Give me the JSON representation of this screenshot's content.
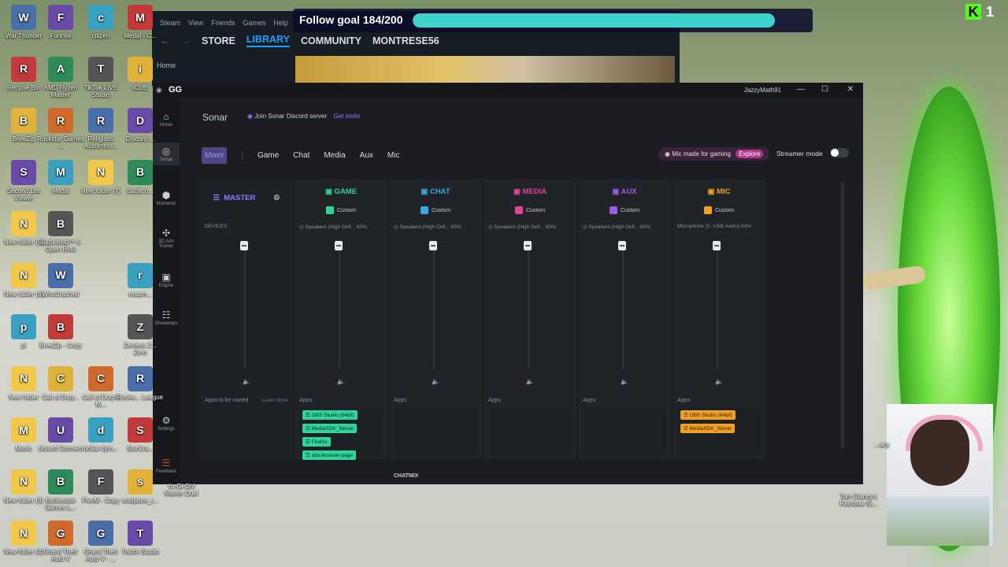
{
  "desktop": {
    "icons_col1": [
      "War Thunder",
      "Recycle Bin",
      "BreeZip",
      "Second Life Viewer",
      "New folder (5)",
      "New folder (6)",
      "pi",
      "New folder",
      "Music",
      "New folder (3)",
      "New folder (4)"
    ],
    "icons_col2": [
      "Fortnite",
      "AMD Ryzen Master",
      "Rockstar Games ...",
      "Medal",
      "Battlefield™ 6 Open Beta",
      "WhoCrashed",
      "BreeZip - Copy",
      "Call of Duty...",
      "Ubisoft Connect",
      "Battlestate Games L...",
      "Grand Theft Auto V"
    ],
    "icons_col3": [
      "citizen",
      "TikTok LIVE Studio",
      "Religious Accommo...",
      "New folder (7)",
      "",
      "",
      "",
      "Call of Duty® M...",
      "dollar-flyin...",
      "FiveM - Copy",
      "Grand Theft Auto V - ..."
    ],
    "icons_col4": [
      "Medal - C...",
      "iCUE",
      "Discord-...",
      "Battle.n...",
      "",
      "resum...",
      "Zenless Z... Zero",
      "Rocke... League",
      "StarCra...",
      "sculpture_r...",
      "Twitch Studio"
    ],
    "extra": [
      "Yu-Gi-Oh! Master Duel",
      "Tom Clancy's Rainbow Si...",
      "...acy"
    ]
  },
  "steam": {
    "menu": [
      "Steam",
      "View",
      "Friends",
      "Games",
      "Help"
    ],
    "nav": [
      "STORE",
      "LIBRARY",
      "COMMUNITY",
      "MONTRESE56"
    ],
    "active_nav": "LIBRARY",
    "home": "Home"
  },
  "overlay": {
    "follow_goal": "Follow goal 184/200",
    "follow_progress": 0.92,
    "kick_count": "1"
  },
  "gg": {
    "title": "GG",
    "user": "JazzyMath91",
    "sidebar": [
      "Home",
      "Sonar",
      "Moments",
      "3D Aim Trainer",
      "Engine",
      "Giveaways",
      "Settings",
      "Feedback"
    ],
    "sonar_title": "Sonar",
    "discord_text": "Join Sonar Discord server",
    "discord_link": "Get invite",
    "tabs": [
      "Mixer",
      "Game",
      "Chat",
      "Media",
      "Aux",
      "Mic"
    ],
    "selected_tab": "Mixer",
    "mic_promo": "Mic made for gaming",
    "mic_explore": "Explore",
    "streamer_mode": "Streamer mode",
    "devices_label": "DEVICES",
    "master": {
      "label": "MASTER",
      "apps_label": "Apps to be routed",
      "learn_more": "Learn More"
    },
    "channels": [
      {
        "name": "GAME",
        "color": "#2fd39a",
        "preset": "Custom",
        "device": "Speakers (High Defi...",
        "level": "80%",
        "apps": [
          "OBS Studio (64bit)",
          "MediaSDK_Server",
          "Firefox",
          "obs-browser-page"
        ]
      },
      {
        "name": "CHAT",
        "color": "#3ba7e0",
        "preset": "Custom",
        "device": "Speakers (High Defi...",
        "level": "80%",
        "apps": []
      },
      {
        "name": "MEDIA",
        "color": "#e0439a",
        "preset": "Custom",
        "device": "Speakers (High Defi...",
        "level": "80%",
        "apps": []
      },
      {
        "name": "AUX",
        "color": "#9a5ce6",
        "preset": "Custom",
        "device": "Speakers (High Defi...",
        "level": "80%",
        "apps": []
      },
      {
        "name": "MIC",
        "color": "#f0a024",
        "preset": "Custom",
        "device": "Microphone (2- USB Audio)",
        "level": "84%",
        "apps": [
          "OBS Studio (64bit)",
          "MediaSDK_Server"
        ]
      }
    ],
    "apps_label": "Apps",
    "chatmix": "CHATMIX"
  }
}
